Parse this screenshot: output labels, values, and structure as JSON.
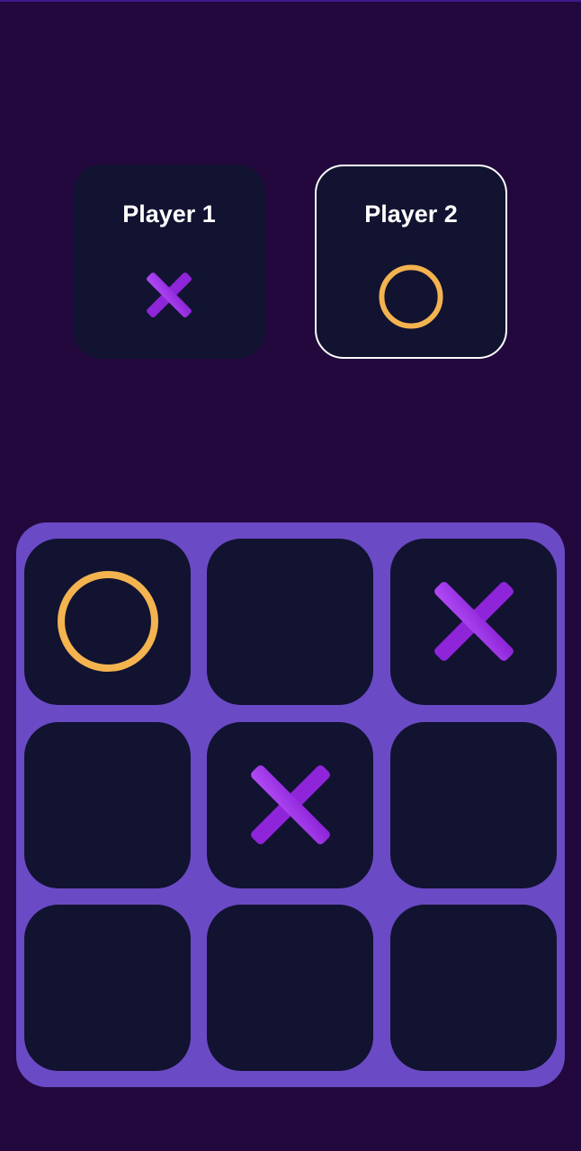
{
  "players": [
    {
      "name": "Player 1",
      "symbol": "X",
      "active": false
    },
    {
      "name": "Player 2",
      "symbol": "O",
      "active": true
    }
  ],
  "board": [
    "O",
    "",
    "X",
    "",
    "X",
    "",
    "",
    "",
    ""
  ],
  "colors": {
    "background": "#22083d",
    "card": "#111331",
    "board": "#6b4ac5",
    "x_mark": "#a033ea",
    "o_mark": "#f3b34f",
    "active_border": "#ffffff"
  }
}
